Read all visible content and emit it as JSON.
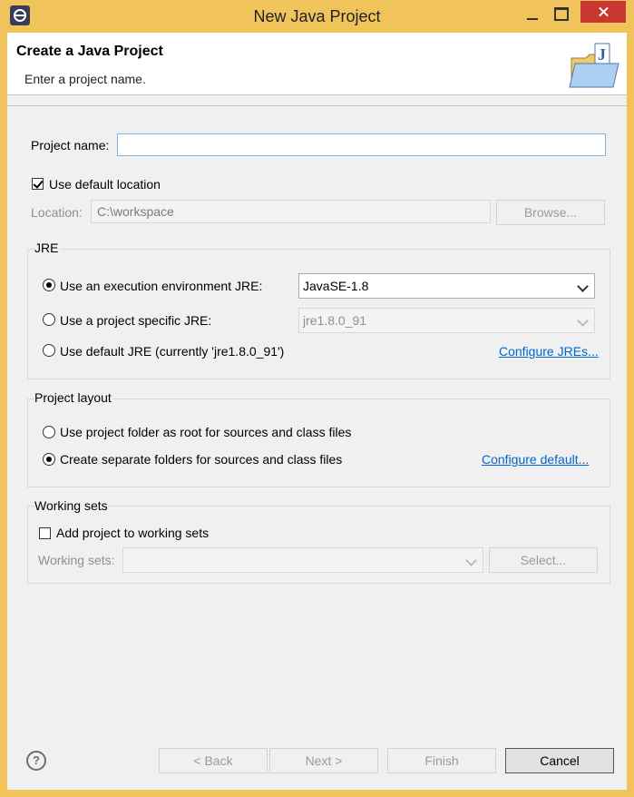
{
  "window": {
    "title": "New Java Project"
  },
  "header": {
    "title": "Create a Java Project",
    "description": "Enter a project name."
  },
  "project_name": {
    "label": "Project name:",
    "value": ""
  },
  "location": {
    "use_default_label": "Use default location",
    "use_default_checked": true,
    "label": "Location:",
    "value": "C:\\workspace",
    "browse_label": "Browse..."
  },
  "jre": {
    "group_title": "JRE",
    "options": [
      {
        "label": "Use an execution environment JRE:",
        "selected": true
      },
      {
        "label": "Use a project specific JRE:",
        "selected": false
      },
      {
        "label": "Use default JRE (currently 'jre1.8.0_91')",
        "selected": false
      }
    ],
    "exec_env_value": "JavaSE-1.8",
    "project_specific_value": "jre1.8.0_91",
    "configure_link": "Configure JREs..."
  },
  "layout": {
    "group_title": "Project layout",
    "options": [
      {
        "label": "Use project folder as root for sources and class files",
        "selected": false
      },
      {
        "label": "Create separate folders for sources and class files",
        "selected": true
      }
    ],
    "configure_link": "Configure default..."
  },
  "working_sets": {
    "group_title": "Working sets",
    "add_label": "Add project to working sets",
    "add_checked": false,
    "label": "Working sets:",
    "value": "",
    "select_label": "Select..."
  },
  "footer": {
    "help_glyph": "?",
    "back_label": "< Back",
    "next_label": "Next >",
    "finish_label": "Finish",
    "cancel_label": "Cancel"
  },
  "colors": {
    "titlebar": "#f0c45a",
    "close": "#c7372f",
    "link": "#0066cc"
  }
}
